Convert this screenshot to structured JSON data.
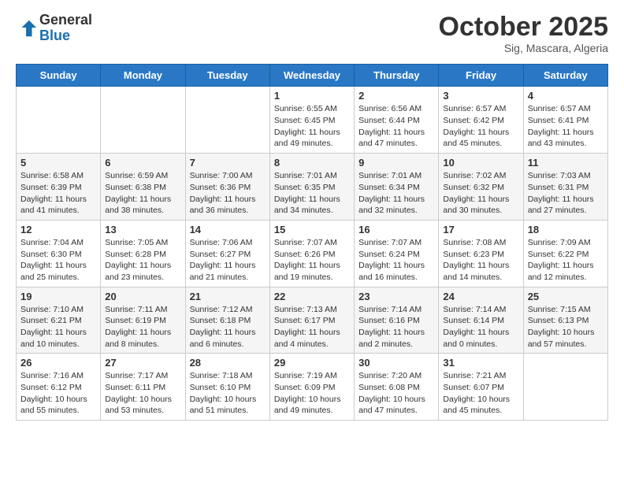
{
  "header": {
    "logo_general": "General",
    "logo_blue": "Blue",
    "month": "October 2025",
    "location": "Sig, Mascara, Algeria"
  },
  "weekdays": [
    "Sunday",
    "Monday",
    "Tuesday",
    "Wednesday",
    "Thursday",
    "Friday",
    "Saturday"
  ],
  "weeks": [
    [
      {
        "num": "",
        "info": ""
      },
      {
        "num": "",
        "info": ""
      },
      {
        "num": "",
        "info": ""
      },
      {
        "num": "1",
        "info": "Sunrise: 6:55 AM\nSunset: 6:45 PM\nDaylight: 11 hours and 49 minutes."
      },
      {
        "num": "2",
        "info": "Sunrise: 6:56 AM\nSunset: 6:44 PM\nDaylight: 11 hours and 47 minutes."
      },
      {
        "num": "3",
        "info": "Sunrise: 6:57 AM\nSunset: 6:42 PM\nDaylight: 11 hours and 45 minutes."
      },
      {
        "num": "4",
        "info": "Sunrise: 6:57 AM\nSunset: 6:41 PM\nDaylight: 11 hours and 43 minutes."
      }
    ],
    [
      {
        "num": "5",
        "info": "Sunrise: 6:58 AM\nSunset: 6:39 PM\nDaylight: 11 hours and 41 minutes."
      },
      {
        "num": "6",
        "info": "Sunrise: 6:59 AM\nSunset: 6:38 PM\nDaylight: 11 hours and 38 minutes."
      },
      {
        "num": "7",
        "info": "Sunrise: 7:00 AM\nSunset: 6:36 PM\nDaylight: 11 hours and 36 minutes."
      },
      {
        "num": "8",
        "info": "Sunrise: 7:01 AM\nSunset: 6:35 PM\nDaylight: 11 hours and 34 minutes."
      },
      {
        "num": "9",
        "info": "Sunrise: 7:01 AM\nSunset: 6:34 PM\nDaylight: 11 hours and 32 minutes."
      },
      {
        "num": "10",
        "info": "Sunrise: 7:02 AM\nSunset: 6:32 PM\nDaylight: 11 hours and 30 minutes."
      },
      {
        "num": "11",
        "info": "Sunrise: 7:03 AM\nSunset: 6:31 PM\nDaylight: 11 hours and 27 minutes."
      }
    ],
    [
      {
        "num": "12",
        "info": "Sunrise: 7:04 AM\nSunset: 6:30 PM\nDaylight: 11 hours and 25 minutes."
      },
      {
        "num": "13",
        "info": "Sunrise: 7:05 AM\nSunset: 6:28 PM\nDaylight: 11 hours and 23 minutes."
      },
      {
        "num": "14",
        "info": "Sunrise: 7:06 AM\nSunset: 6:27 PM\nDaylight: 11 hours and 21 minutes."
      },
      {
        "num": "15",
        "info": "Sunrise: 7:07 AM\nSunset: 6:26 PM\nDaylight: 11 hours and 19 minutes."
      },
      {
        "num": "16",
        "info": "Sunrise: 7:07 AM\nSunset: 6:24 PM\nDaylight: 11 hours and 16 minutes."
      },
      {
        "num": "17",
        "info": "Sunrise: 7:08 AM\nSunset: 6:23 PM\nDaylight: 11 hours and 14 minutes."
      },
      {
        "num": "18",
        "info": "Sunrise: 7:09 AM\nSunset: 6:22 PM\nDaylight: 11 hours and 12 minutes."
      }
    ],
    [
      {
        "num": "19",
        "info": "Sunrise: 7:10 AM\nSunset: 6:21 PM\nDaylight: 11 hours and 10 minutes."
      },
      {
        "num": "20",
        "info": "Sunrise: 7:11 AM\nSunset: 6:19 PM\nDaylight: 11 hours and 8 minutes."
      },
      {
        "num": "21",
        "info": "Sunrise: 7:12 AM\nSunset: 6:18 PM\nDaylight: 11 hours and 6 minutes."
      },
      {
        "num": "22",
        "info": "Sunrise: 7:13 AM\nSunset: 6:17 PM\nDaylight: 11 hours and 4 minutes."
      },
      {
        "num": "23",
        "info": "Sunrise: 7:14 AM\nSunset: 6:16 PM\nDaylight: 11 hours and 2 minutes."
      },
      {
        "num": "24",
        "info": "Sunrise: 7:14 AM\nSunset: 6:14 PM\nDaylight: 11 hours and 0 minutes."
      },
      {
        "num": "25",
        "info": "Sunrise: 7:15 AM\nSunset: 6:13 PM\nDaylight: 10 hours and 57 minutes."
      }
    ],
    [
      {
        "num": "26",
        "info": "Sunrise: 7:16 AM\nSunset: 6:12 PM\nDaylight: 10 hours and 55 minutes."
      },
      {
        "num": "27",
        "info": "Sunrise: 7:17 AM\nSunset: 6:11 PM\nDaylight: 10 hours and 53 minutes."
      },
      {
        "num": "28",
        "info": "Sunrise: 7:18 AM\nSunset: 6:10 PM\nDaylight: 10 hours and 51 minutes."
      },
      {
        "num": "29",
        "info": "Sunrise: 7:19 AM\nSunset: 6:09 PM\nDaylight: 10 hours and 49 minutes."
      },
      {
        "num": "30",
        "info": "Sunrise: 7:20 AM\nSunset: 6:08 PM\nDaylight: 10 hours and 47 minutes."
      },
      {
        "num": "31",
        "info": "Sunrise: 7:21 AM\nSunset: 6:07 PM\nDaylight: 10 hours and 45 minutes."
      },
      {
        "num": "",
        "info": ""
      }
    ]
  ]
}
